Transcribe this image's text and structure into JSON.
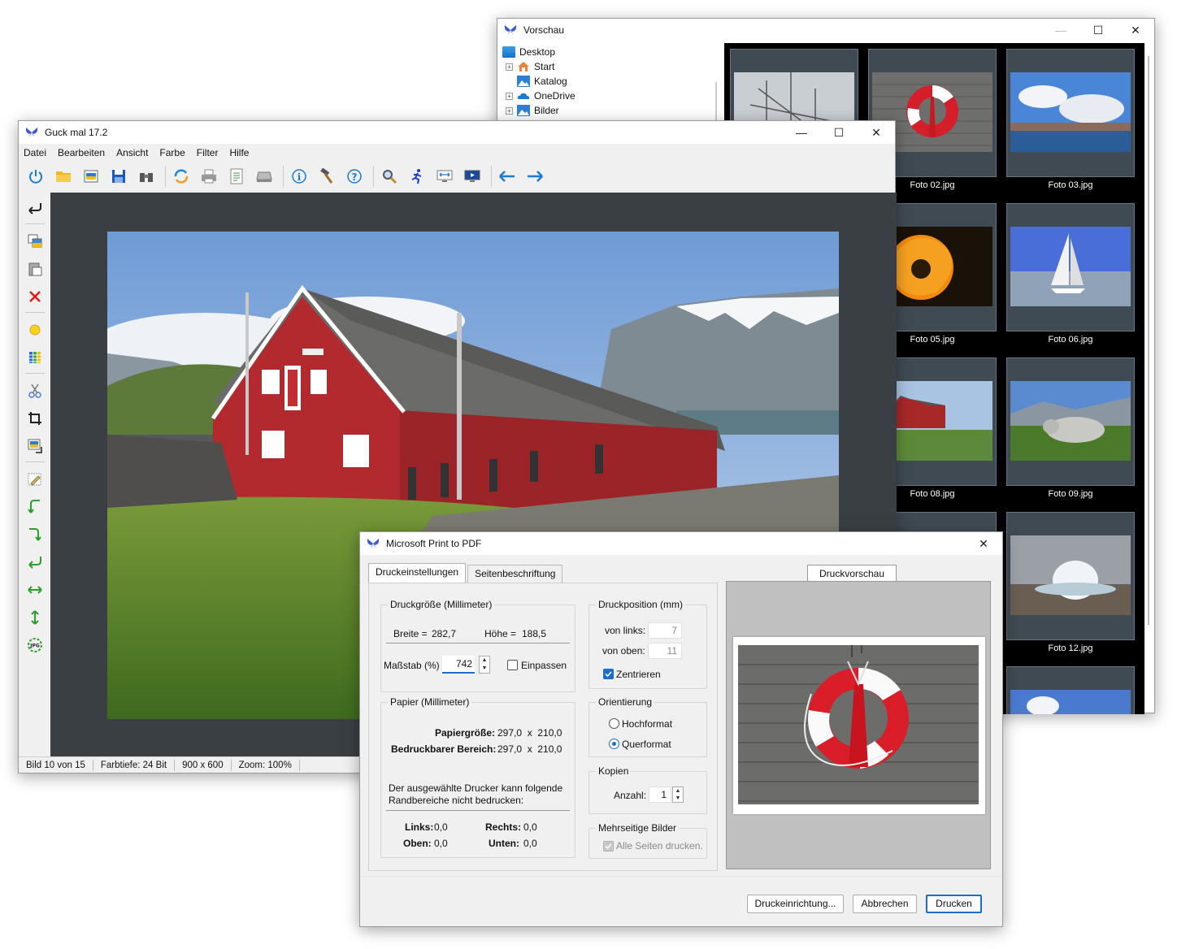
{
  "colors": {
    "accent": "#1a6dcc",
    "canvas_bg": "#3a3f44",
    "thumb_bg": "#3f4a52"
  },
  "vorschau": {
    "title": "Vorschau",
    "tree": [
      {
        "label": "Desktop",
        "icon": "desktop-icon"
      },
      {
        "label": "Start",
        "icon": "home-icon"
      },
      {
        "label": "Katalog",
        "icon": "image-icon"
      },
      {
        "label": "OneDrive",
        "icon": "cloud-icon"
      },
      {
        "label": "Bilder",
        "icon": "image-icon"
      }
    ],
    "thumbs": [
      {
        "label": "",
        "img": "ship"
      },
      {
        "label": "Foto 02.jpg",
        "img": "lifebuoy"
      },
      {
        "label": "Foto 03.jpg",
        "img": "town"
      },
      {
        "label": "Foto 05.jpg",
        "img": "tulip"
      },
      {
        "label": "Foto 06.jpg",
        "img": "sailboat"
      },
      {
        "label": "Foto 08.jpg",
        "img": "house"
      },
      {
        "label": "Foto 09.jpg",
        "img": "cow"
      },
      {
        "label": "Foto 12.jpg",
        "img": "geyser"
      }
    ]
  },
  "guck": {
    "title": "Guck mal 17.2",
    "menu": [
      "Datei",
      "Bearbeiten",
      "Ansicht",
      "Farbe",
      "Filter",
      "Hilfe"
    ],
    "status": [
      "Bild 10 von 15",
      "Farbtiefe: 24 Bit",
      "900 x 600",
      "Zoom: 100%"
    ]
  },
  "print": {
    "title": "Microsoft Print to PDF",
    "tab_settings": "Druckeinstellungen",
    "tab_caption": "Seitenbeschriftung",
    "druckgroesse_label": "Druckgröße (Millimeter)",
    "breite_label": "Breite =",
    "breite_value": "282,7",
    "hoehe_label": "Höhe =",
    "hoehe_value": "188,5",
    "massstab_label": "Maßstab (%)",
    "massstab_value": "742",
    "einpassen_label": "Einpassen",
    "papier_label": "Papier (Millimeter)",
    "papiergroesse_label": "Papiergröße:",
    "papiergroesse_value": "297,0  x  210,0",
    "bedruckbar_label": "Bedruckbarer Bereich:",
    "bedruckbar_value": "297,0  x  210,0",
    "note": "Der ausgewählte Drucker kann folgende Randbereiche nicht bedrucken:",
    "links_label": "Links:",
    "links_value": "0,0",
    "rechts_label": "Rechts:",
    "rechts_value": "0,0",
    "oben_label": "Oben:",
    "oben_value": "0,0",
    "unten_label": "Unten:",
    "unten_value": "0,0",
    "druckposition_label": "Druckposition (mm)",
    "von_links_label": "von links:",
    "von_links_value": "7",
    "von_oben_label": "von oben:",
    "von_oben_value": "11",
    "zentrieren_label": "Zentrieren",
    "orientierung_label": "Orientierung",
    "hochformat_label": "Hochformat",
    "querformat_label": "Querformat",
    "kopien_label": "Kopien",
    "anzahl_label": "Anzahl:",
    "anzahl_value": "1",
    "mehrseitig_label": "Mehrseitige Bilder",
    "alle_seiten_label": "Alle Seiten drucken.",
    "preview_tab": "Druckvorschau",
    "btn_setup": "Druckeinrichtung...",
    "btn_cancel": "Abbrechen",
    "btn_print": "Drucken"
  }
}
